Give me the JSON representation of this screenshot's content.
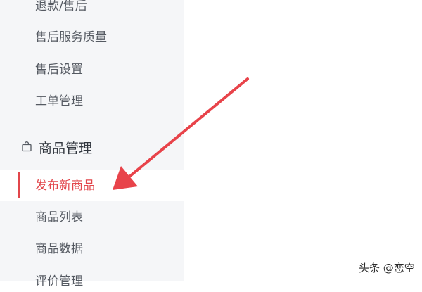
{
  "sidebar": {
    "items_top": [
      {
        "label": "退款/售后"
      },
      {
        "label": "售后服务质量"
      },
      {
        "label": "售后设置"
      },
      {
        "label": "工单管理"
      }
    ],
    "group": {
      "label": "商品管理",
      "icon": "shopping-bag-icon",
      "items": [
        {
          "label": "发布新商品",
          "active": true
        },
        {
          "label": "商品列表"
        },
        {
          "label": "商品数据"
        },
        {
          "label": "评价管理"
        }
      ]
    }
  },
  "colors": {
    "sidebar_bg": "#f5f6f8",
    "active": "#e2464b",
    "text": "#555a62",
    "arrow": "#e8434a"
  },
  "watermark": {
    "text": "头条 @恋空"
  }
}
